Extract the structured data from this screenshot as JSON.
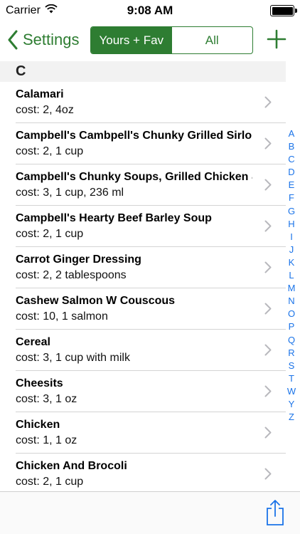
{
  "status_bar": {
    "carrier": "Carrier",
    "time": "9:08 AM"
  },
  "nav": {
    "back_label": "Settings",
    "segments": [
      "Yours + Fav",
      "All"
    ],
    "active_segment": "Yours + Fav"
  },
  "section": {
    "header": "C"
  },
  "items": [
    {
      "title": "Calamari",
      "subtitle": "cost: 2, 4oz"
    },
    {
      "title": "Campbell's Cambpell's Chunky Grilled Sirloin",
      "subtitle": "cost: 2, 1 cup"
    },
    {
      "title": "Campbell's Chunky Soups, Grilled Chicken & Sausage Gumbo",
      "subtitle": "cost: 3, 1 cup, 236 ml"
    },
    {
      "title": "Campbell's Hearty Beef Barley Soup",
      "subtitle": "cost: 2, 1 cup"
    },
    {
      "title": "Carrot Ginger Dressing",
      "subtitle": "cost: 2, 2 tablespoons"
    },
    {
      "title": "Cashew Salmon W Couscous",
      "subtitle": "cost: 10, 1 salmon"
    },
    {
      "title": "Cereal",
      "subtitle": "cost: 3, 1 cup with milk"
    },
    {
      "title": "Cheesits",
      "subtitle": "cost: 3, 1 oz"
    },
    {
      "title": "Chicken",
      "subtitle": "cost: 1, 1 oz"
    },
    {
      "title": "Chicken And Brocoli",
      "subtitle": "cost: 2, 1 cup"
    }
  ],
  "index_letters": [
    "A",
    "B",
    "C",
    "D",
    "E",
    "F",
    "G",
    "H",
    "I",
    "J",
    "K",
    "L",
    "M",
    "N",
    "O",
    "P",
    "Q",
    "R",
    "S",
    "T",
    "W",
    "Y",
    "Z"
  ],
  "icons": {
    "back": "chevron-left-icon",
    "add": "plus-icon",
    "row": "chevron-right-icon",
    "share": "share-icon",
    "wifi": "wifi-icon",
    "battery": "battery-icon"
  },
  "colors": {
    "accent": "#2e7d32",
    "index": "#1a73e8",
    "section_bg": "#f2f2f2"
  }
}
